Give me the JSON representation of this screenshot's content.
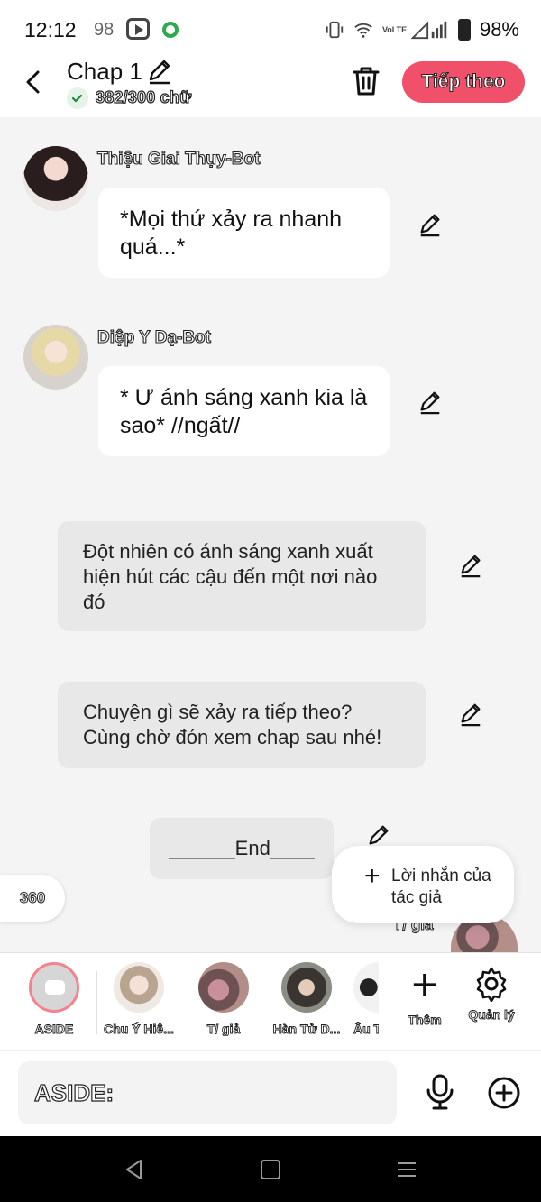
{
  "status_bar": {
    "time": "12:12",
    "notification_count": "98",
    "battery": "98%",
    "network_label": "VoLTE"
  },
  "header": {
    "title": "Chap 1",
    "word_count": "382/300 chữ",
    "next_button": "Tiếp theo"
  },
  "messages": [
    {
      "speaker": "Thiệu Giai Thụy-Bot",
      "text": "*Mọi thứ xảy ra nhanh quá...*"
    },
    {
      "speaker": "Diệp Y Dạ-Bot",
      "text": "* Ư ánh sáng xanh kia là sao* //ngất//"
    },
    {
      "text": "Đột nhiên có ánh sáng xanh xuất hiện  hút các cậu đến một nơi nào đó"
    },
    {
      "text": "Chuyện gì sẽ xảy ra tiếp theo? Cùng chờ đón xem chap sau nhé!"
    },
    {
      "text": "______End____"
    }
  ],
  "view_badge": "360",
  "author_note_button": "Lời nhắn của tác giả",
  "peek_label": "T/ giả",
  "characters": [
    {
      "label": "ASIDE"
    },
    {
      "label": "Chu Ý Hiê..."
    },
    {
      "label": "T/ giả"
    },
    {
      "label": "Hàn Tử D..."
    },
    {
      "label": "Âu T"
    }
  ],
  "toolbar": {
    "add_label": "Thêm",
    "manage_label": "Quản lý"
  },
  "input": {
    "value": "ASIDE:"
  },
  "colors": {
    "accent": "#f0506a",
    "background": "#f4f4f4",
    "bubble_grey": "#e8e8e8"
  }
}
